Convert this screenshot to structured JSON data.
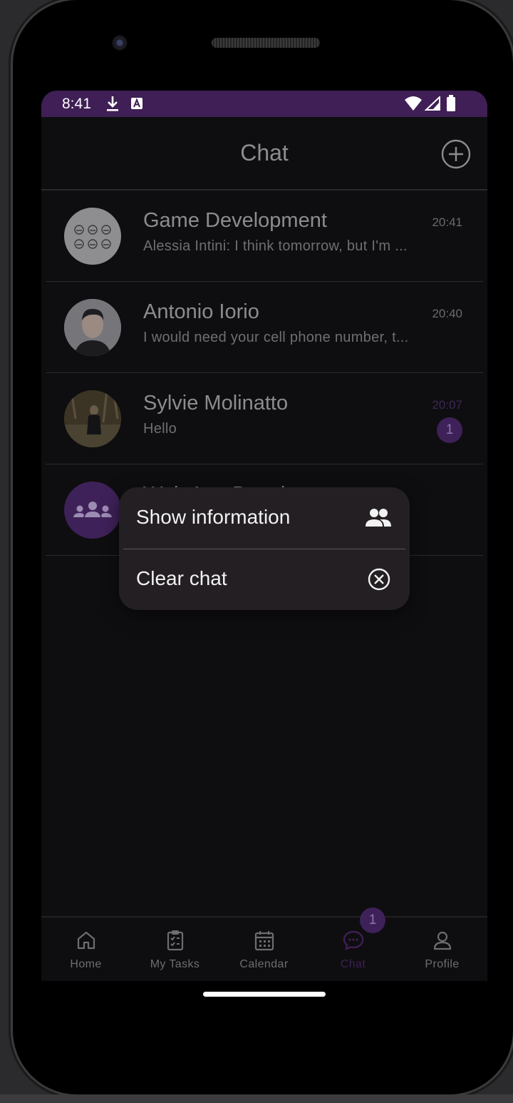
{
  "status_bar": {
    "time": "8:41",
    "icons": [
      "download-icon",
      "keyboard-a-icon",
      "wifi-icon",
      "signal-icon",
      "battery-icon"
    ]
  },
  "app_bar": {
    "title": "Chat",
    "add_button_icon": "add-circle-icon"
  },
  "chats": [
    {
      "name": "Game Development",
      "preview": "Alessia Intini: I think tomorrow, but I'm ...",
      "time": "20:41",
      "avatar": "group-faces-avatar",
      "unread": null
    },
    {
      "name": "Antonio Iorio",
      "preview": "I would need your cell phone number, t...",
      "time": "20:40",
      "avatar": "photo-avatar",
      "unread": null
    },
    {
      "name": "Sylvie Molinatto",
      "preview": "Hello",
      "time": "20:07",
      "avatar": "photo-avatar",
      "unread": "1"
    },
    {
      "name": "Web App Development",
      "preview": "",
      "time": "",
      "avatar": "group-avatar",
      "unread": null
    }
  ],
  "context_menu": {
    "items": [
      {
        "label": "Show information",
        "icon": "people-icon"
      },
      {
        "label": "Clear chat",
        "icon": "close-circle-icon"
      }
    ]
  },
  "bottom_nav": {
    "items": [
      {
        "label": "Home",
        "icon": "home-icon",
        "active": false
      },
      {
        "label": "My Tasks",
        "icon": "tasks-clipboard-icon",
        "active": false
      },
      {
        "label": "Calendar",
        "icon": "calendar-icon",
        "active": false
      },
      {
        "label": "Chat",
        "icon": "chat-bubble-icon",
        "active": true
      },
      {
        "label": "Profile",
        "icon": "profile-icon",
        "active": false
      }
    ],
    "chat_badge": "1"
  },
  "colors": {
    "accent": "#3f1f55",
    "background": "#0e0e10",
    "menu_background": "#231f22"
  }
}
